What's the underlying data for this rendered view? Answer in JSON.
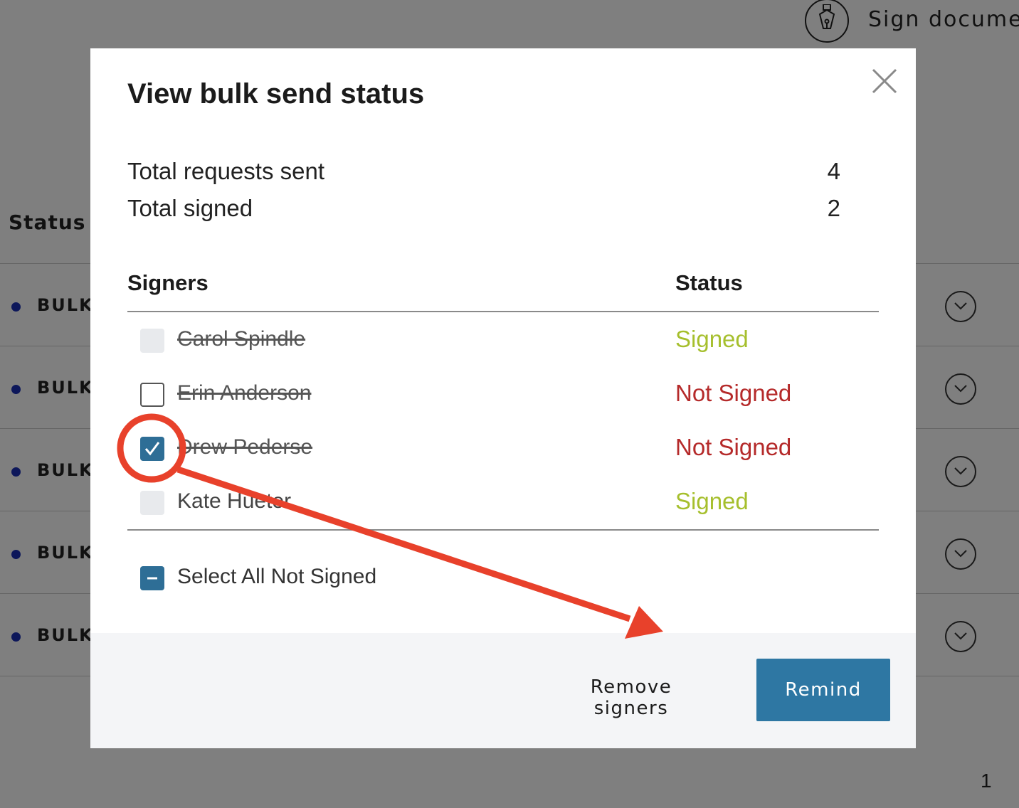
{
  "background": {
    "top_action_label": "Sign documen",
    "top_action_icon": "pen-nib-icon",
    "status_column_header": "Status",
    "rows": [
      {
        "name": "BULK_"
      },
      {
        "name": "BULK_"
      },
      {
        "name": "BULK_"
      },
      {
        "name": "BULK_"
      },
      {
        "name": "BULK_"
      }
    ],
    "page_number": "1"
  },
  "modal": {
    "title": "View bulk send status",
    "close_icon": "close-icon",
    "summary": {
      "total_sent_label": "Total requests sent",
      "total_sent_value": "4",
      "total_signed_label": "Total signed",
      "total_signed_value": "2"
    },
    "table": {
      "signers_header": "Signers",
      "status_header": "Status",
      "rows": [
        {
          "name": "Carol Spindle",
          "status": "Signed",
          "checkbox": "disabled"
        },
        {
          "name": "Erin Anderson",
          "status": "Not Signed",
          "checkbox": "unchecked"
        },
        {
          "name": "Drew Pederse",
          "status": "Not Signed",
          "checkbox": "checked"
        },
        {
          "name": "Kate Hueter",
          "status": "Signed",
          "checkbox": "disabled"
        }
      ]
    },
    "select_all_label": "Select All Not Signed",
    "footer": {
      "remove_label": "Remove signers",
      "remind_label": "Remind"
    }
  },
  "colors": {
    "signed": "#a6bf2d",
    "not_signed": "#b52a2a",
    "primary_button": "#2e77a3",
    "annotation": "#e8412b"
  }
}
